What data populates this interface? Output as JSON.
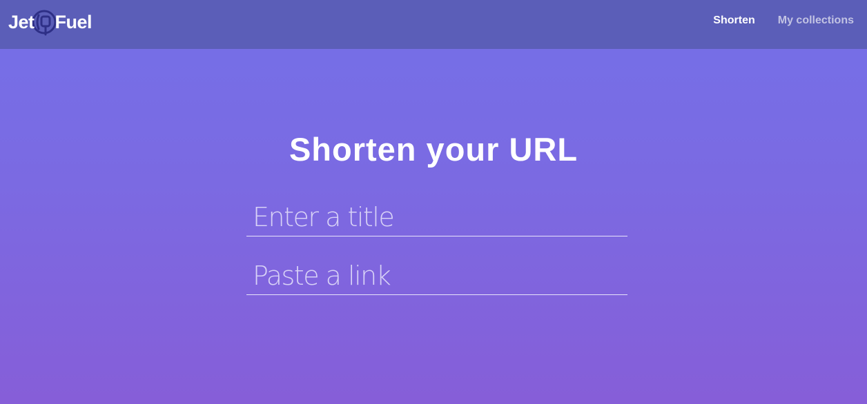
{
  "navbar": {
    "brand": {
      "part1": "Jet",
      "part2": "Fuel",
      "icon": "fuel-nozzle-logo-icon"
    },
    "links": [
      {
        "label": "Shorten",
        "active": true
      },
      {
        "label": "My collections",
        "active": false
      }
    ]
  },
  "main": {
    "heading": "Shorten your URL",
    "title_input": {
      "placeholder": "Enter a title",
      "value": ""
    },
    "link_input": {
      "placeholder": "Paste a link",
      "value": ""
    }
  },
  "colors": {
    "navbar_bg": "#5b5eb8",
    "background_top": "#7470e8",
    "background_bottom": "#865ed8",
    "logo_icon": "#2e2f86",
    "inactive_link": "#c2c3e3"
  }
}
